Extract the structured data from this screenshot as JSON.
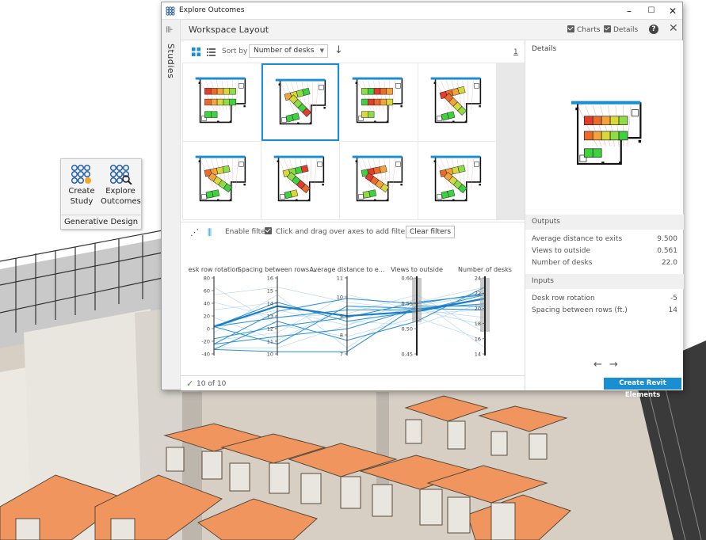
{
  "window": {
    "title": "Explore Outcomes",
    "minimize": "–",
    "maximize": "☐",
    "close": "✕",
    "collapse_glyph": "⊪"
  },
  "sidebar": {
    "label": "Studies"
  },
  "header": {
    "title": "Workspace Layout",
    "charts_label": "Charts",
    "details_label": "Details",
    "help": "?",
    "close": "✕"
  },
  "toolbar": {
    "sort_label": "Sort by",
    "sort_value": "Number of desks",
    "sort_dir_glyph": "↓",
    "page": "1"
  },
  "filters": {
    "enable_label": "Enable filters",
    "hint": "Click and drag over axes to add filters",
    "clear_label": "Clear filters"
  },
  "axes": [
    {
      "label": "esk row rotation",
      "ticks": [
        "80",
        "60",
        "40",
        "20",
        "0",
        "-20",
        "-40"
      ]
    },
    {
      "label": "Spacing between rows ...",
      "ticks": [
        "16",
        "15",
        "14",
        "13",
        "12",
        "11",
        "10"
      ]
    },
    {
      "label": "Average distance to e...",
      "ticks": [
        "11",
        "10",
        "9",
        "8",
        "7"
      ]
    },
    {
      "label": "Views to outside",
      "ticks": [
        "0.60",
        "0.55",
        "0.50",
        "0.45"
      ]
    },
    {
      "label": "Number of desks",
      "ticks": [
        "24",
        "22",
        "20",
        "18",
        "16",
        "14"
      ]
    }
  ],
  "status": {
    "count": "10 of 10"
  },
  "details": {
    "title": "Details",
    "outputs_title": "Outputs",
    "outputs": [
      {
        "label": "Average distance to exits",
        "value": "9.500"
      },
      {
        "label": "Views to outside",
        "value": "0.561"
      },
      {
        "label": "Number of desks",
        "value": "22.0"
      }
    ],
    "inputs_title": "Inputs",
    "inputs": [
      {
        "label": "Desk row rotation",
        "value": "-5"
      },
      {
        "label": "Spacing between rows (ft.)",
        "value": "14"
      }
    ],
    "prev": "←",
    "next": "→",
    "create_button": "Create Revit Elements"
  },
  "ribbon": {
    "create_study": "Create\nStudy",
    "explore_outcomes": "Explore\nOutcomes",
    "panel_label": "Generative Design"
  },
  "colors": {
    "accent": "#1b8ed1",
    "desk": "#f0955e",
    "line": "#2a8fd4"
  }
}
